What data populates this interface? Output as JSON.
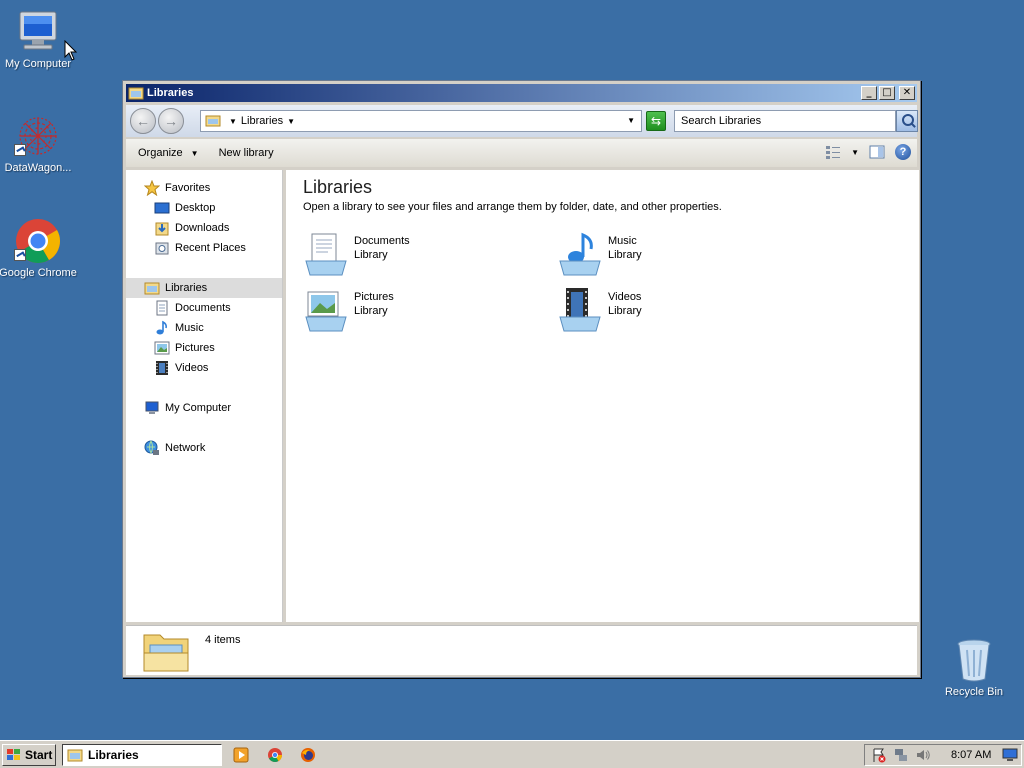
{
  "desktop": {
    "icons": [
      {
        "label": "My Computer",
        "icon": "computer-icon"
      },
      {
        "label": "DataWagon...",
        "icon": "datawagon-icon"
      },
      {
        "label": "Google Chrome",
        "icon": "chrome-icon"
      },
      {
        "label": "Recycle Bin",
        "icon": "recycle-bin-icon"
      }
    ]
  },
  "window": {
    "title": "Libraries",
    "address": {
      "segment": "Libraries"
    },
    "search": {
      "placeholder": "Search Libraries"
    },
    "toolbar": {
      "organize": "Organize",
      "new_library": "New library"
    },
    "nav": {
      "favorites": "Favorites",
      "favorites_items": [
        "Desktop",
        "Downloads",
        "Recent Places"
      ],
      "libraries": "Libraries",
      "libraries_items": [
        "Documents",
        "Music",
        "Pictures",
        "Videos"
      ],
      "my_computer": "My Computer",
      "network": "Network"
    },
    "content": {
      "title": "Libraries",
      "description": "Open a library to see your files and arrange them by folder, date, and other properties.",
      "libraries": [
        {
          "name": "Documents",
          "type": "Library"
        },
        {
          "name": "Music",
          "type": "Library"
        },
        {
          "name": "Pictures",
          "type": "Library"
        },
        {
          "name": "Videos",
          "type": "Library"
        }
      ]
    },
    "details": {
      "count": "4 items"
    }
  },
  "taskbar": {
    "start": "Start",
    "task": "Libraries",
    "clock": "8:07 AM"
  },
  "colors": {
    "desktop": "#3a6ea5",
    "titlebar_start": "#0a246a",
    "titlebar_end": "#a6caf0"
  }
}
